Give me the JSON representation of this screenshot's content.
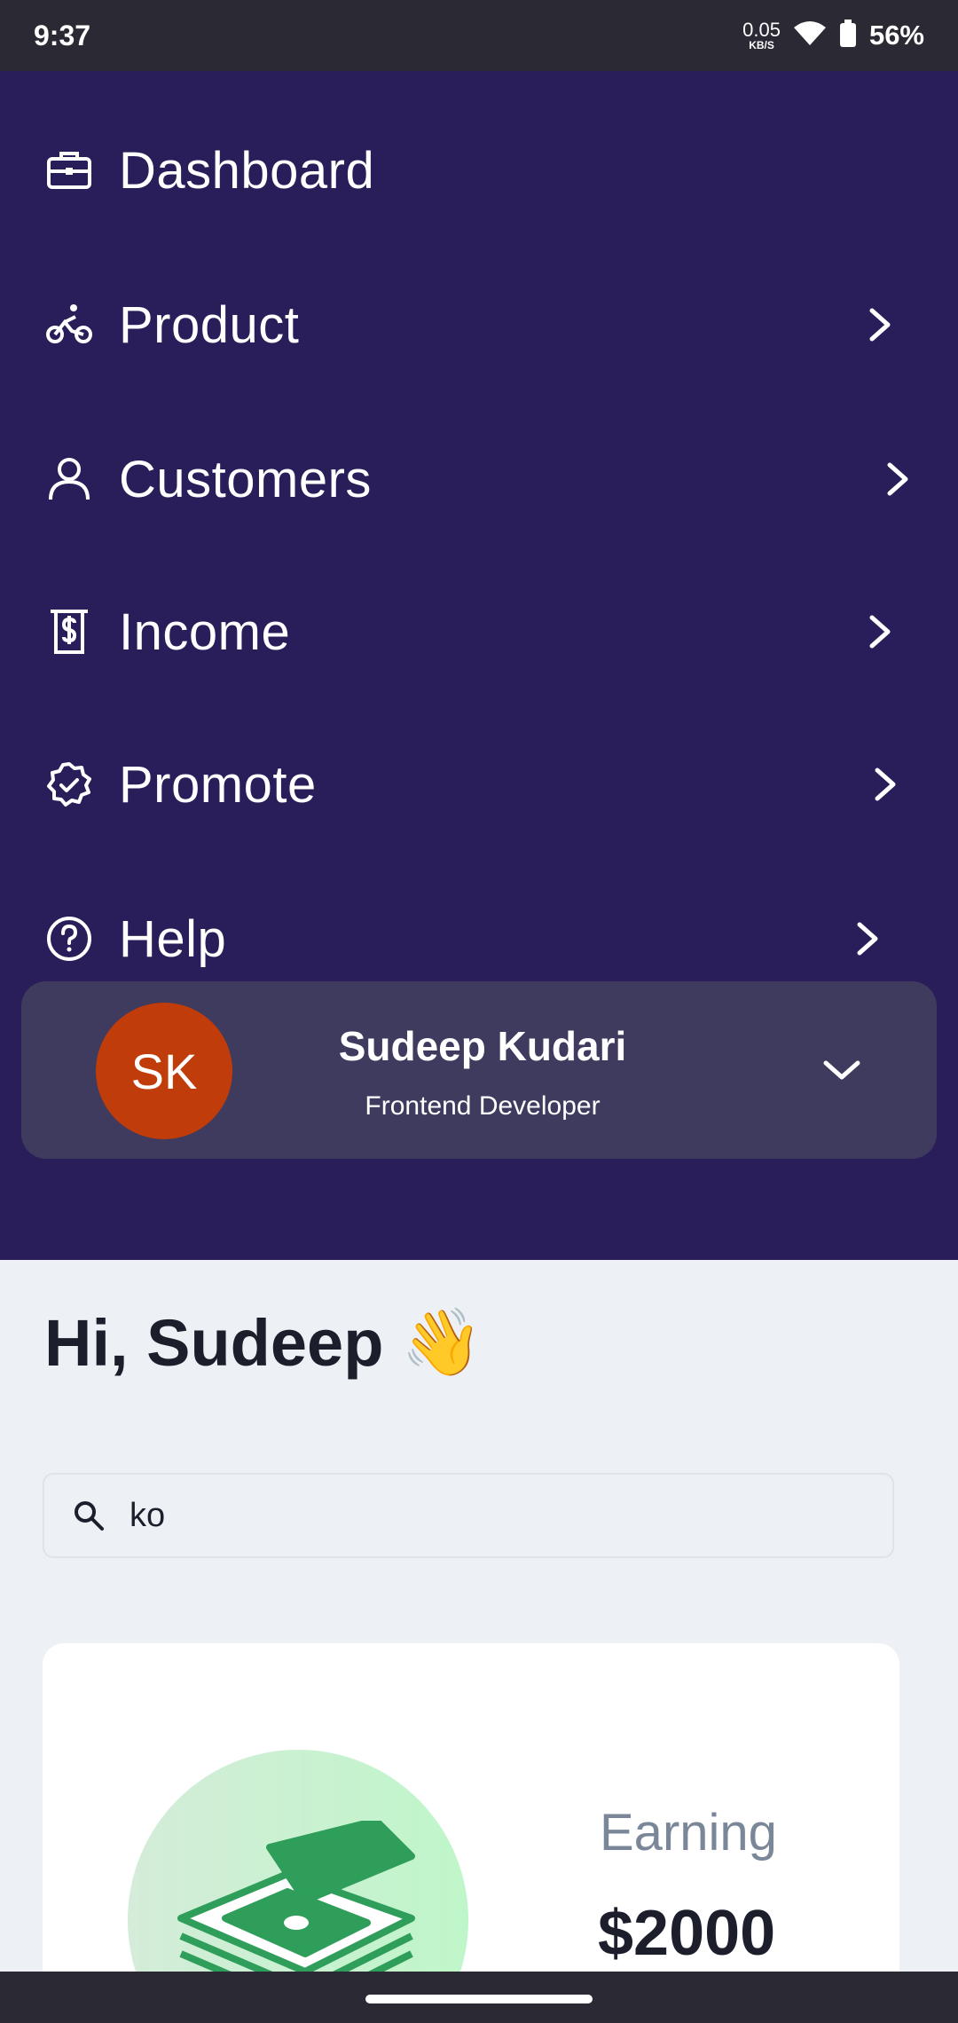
{
  "status_bar": {
    "time": "9:37",
    "net_speed_value": "0.05",
    "net_speed_unit": "KB/S",
    "battery": "56%"
  },
  "menu": {
    "items": [
      {
        "label": "Dashboard",
        "icon": "briefcase-icon",
        "has_chevron": false
      },
      {
        "label": "Product",
        "icon": "bicycle-icon",
        "has_chevron": true
      },
      {
        "label": "Customers",
        "icon": "user-icon",
        "has_chevron": true
      },
      {
        "label": "Income",
        "icon": "dollar-receipt-icon",
        "has_chevron": true
      },
      {
        "label": "Promote",
        "icon": "badge-check-icon",
        "has_chevron": true
      },
      {
        "label": "Help",
        "icon": "help-circle-icon",
        "has_chevron": true
      }
    ]
  },
  "profile": {
    "initials": "SK",
    "name": "Sudeep Kudari",
    "role": "Frontend Developer"
  },
  "greeting": {
    "text": "Hi, Sudeep",
    "emoji": "👋"
  },
  "search": {
    "value": "ko",
    "placeholder": ""
  },
  "earning": {
    "label": "Earning",
    "value": "$2000"
  },
  "colors": {
    "drawer_bg": "#291e59",
    "profile_card_bg": "#3e3b5e",
    "avatar_bg": "#c03c0a",
    "page_bg": "#edf1f5",
    "money_green": "#2f9e5b"
  }
}
